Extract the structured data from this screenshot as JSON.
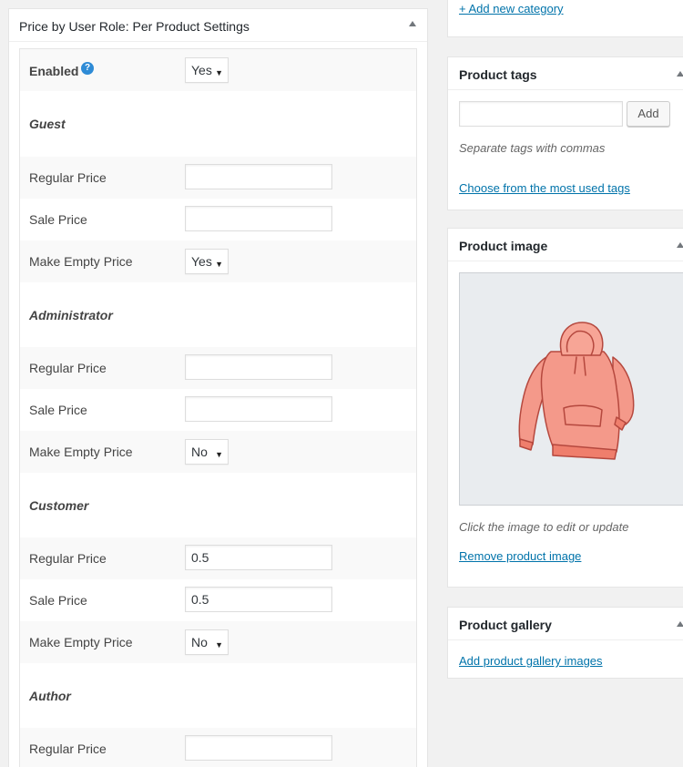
{
  "left_panel": {
    "title": "Price by User Role: Per Product Settings",
    "enabled": {
      "label": "Enabled",
      "help": "?",
      "value": "Yes"
    },
    "roles": [
      {
        "name": "Guest",
        "regular_label": "Regular Price",
        "regular_value": "",
        "sale_label": "Sale Price",
        "sale_value": "",
        "empty_label": "Make Empty Price",
        "empty_value": "Yes"
      },
      {
        "name": "Administrator",
        "regular_label": "Regular Price",
        "regular_value": "",
        "sale_label": "Sale Price",
        "sale_value": "",
        "empty_label": "Make Empty Price",
        "empty_value": "No"
      },
      {
        "name": "Customer",
        "regular_label": "Regular Price",
        "regular_value": "0.5",
        "sale_label": "Sale Price",
        "sale_value": "0.5",
        "empty_label": "Make Empty Price",
        "empty_value": "No"
      },
      {
        "name": "Author",
        "regular_label": "Regular Price",
        "regular_value": ""
      }
    ]
  },
  "right": {
    "add_category": "+ Add new category",
    "tags": {
      "title": "Product tags",
      "add_label": "Add",
      "hint": "Separate tags with commas",
      "choose_link": "Choose from the most used tags"
    },
    "image": {
      "title": "Product image",
      "hint": "Click the image to edit or update",
      "remove_link": "Remove product image"
    },
    "gallery": {
      "title": "Product gallery",
      "add_link": "Add product gallery images"
    }
  },
  "colors": {
    "link": "#0073aa",
    "hoodie": "#f4998a",
    "help_icon": "#2e8bd6"
  }
}
